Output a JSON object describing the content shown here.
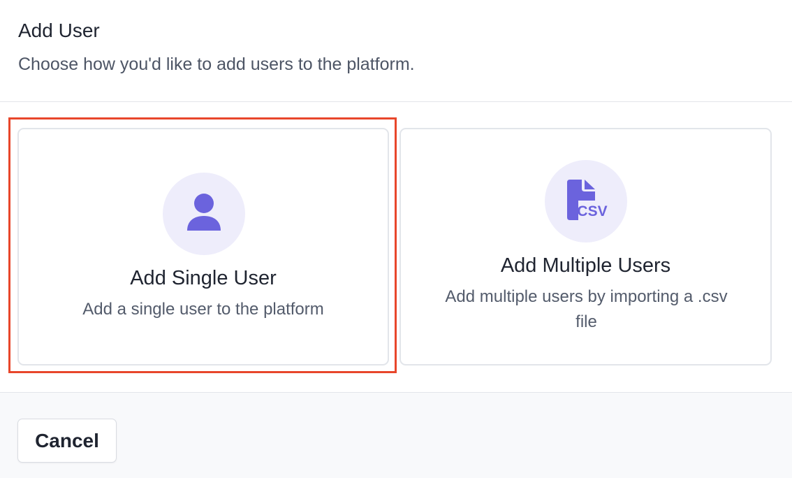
{
  "dialog": {
    "title": "Add User",
    "subtitle": "Choose how you'd like to add users to the platform."
  },
  "options": [
    {
      "title": "Add Single User",
      "description": "Add a single user to the platform",
      "icon": "user-icon",
      "selected": true
    },
    {
      "title": "Add Multiple Users",
      "description": "Add multiple users by importing a .csv file",
      "icon": "csv-file-icon",
      "icon_text": "CSV",
      "selected": false
    }
  ],
  "footer": {
    "cancel_label": "Cancel"
  },
  "colors": {
    "accent": "#6b63dd",
    "icon_background": "#eeedfb",
    "highlight": "#e8462b",
    "card_border": "#e2e5ea"
  }
}
